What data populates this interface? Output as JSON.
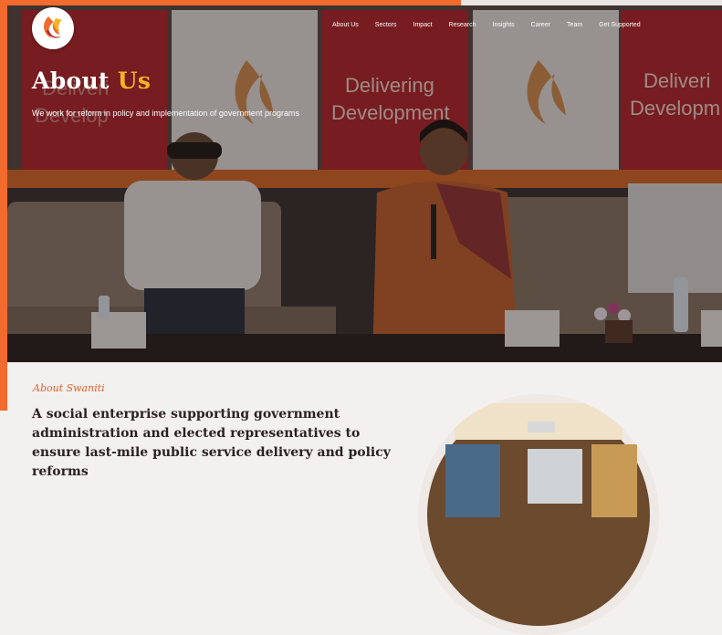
{
  "nav": {
    "items": [
      "About Us",
      "Sectors",
      "Impact",
      "Research",
      "Insights",
      "Career",
      "Team",
      "Get Supported"
    ]
  },
  "hero": {
    "title_main": "About",
    "title_accent": "Us",
    "subtitle": "We work for reform in policy and implementation of government programs",
    "banner_text_line1": "Delivering",
    "banner_text_line2": "Development",
    "banner_text_line1_right": "Deliveri",
    "banner_text_line2_right": "Developm",
    "ghost_text_left": "Deliveri",
    "ghost_text_left2": "Develop"
  },
  "about": {
    "tag": "About Swaniti",
    "heading": "A social enterprise supporting government administration and elected representatives to ensure last-mile public service delivery and policy reforms"
  },
  "colors": {
    "brand_orange": "#f26a2e",
    "accent_yellow": "#f5b323",
    "banner_red": "#b3262c",
    "heading_dark": "#2a2222"
  }
}
